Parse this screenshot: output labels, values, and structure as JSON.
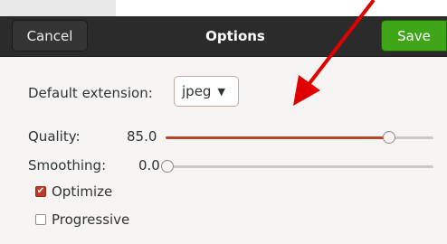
{
  "header": {
    "cancel_label": "Cancel",
    "title": "Options",
    "save_label": "Save"
  },
  "options": {
    "default_extension": {
      "label": "Default extension:",
      "value": "jpeg"
    },
    "quality": {
      "label": "Quality:",
      "value_text": "85.0",
      "value": 85.0,
      "max": 100
    },
    "smoothing": {
      "label": "Smoothing:",
      "value_text": "0.0",
      "value": 0.0,
      "max": 100
    },
    "optimize": {
      "label": "Optimize",
      "checked": true
    },
    "progressive": {
      "label": "Progressive",
      "checked": false
    }
  },
  "colors": {
    "accent": "#b5482b",
    "save_green": "#3ea618",
    "headerbar": "#2b2b2b",
    "annotation_arrow": "#e00000"
  },
  "icons": {
    "dropdown": "chevron-down-icon",
    "optimize_check": "checkmark-icon"
  }
}
